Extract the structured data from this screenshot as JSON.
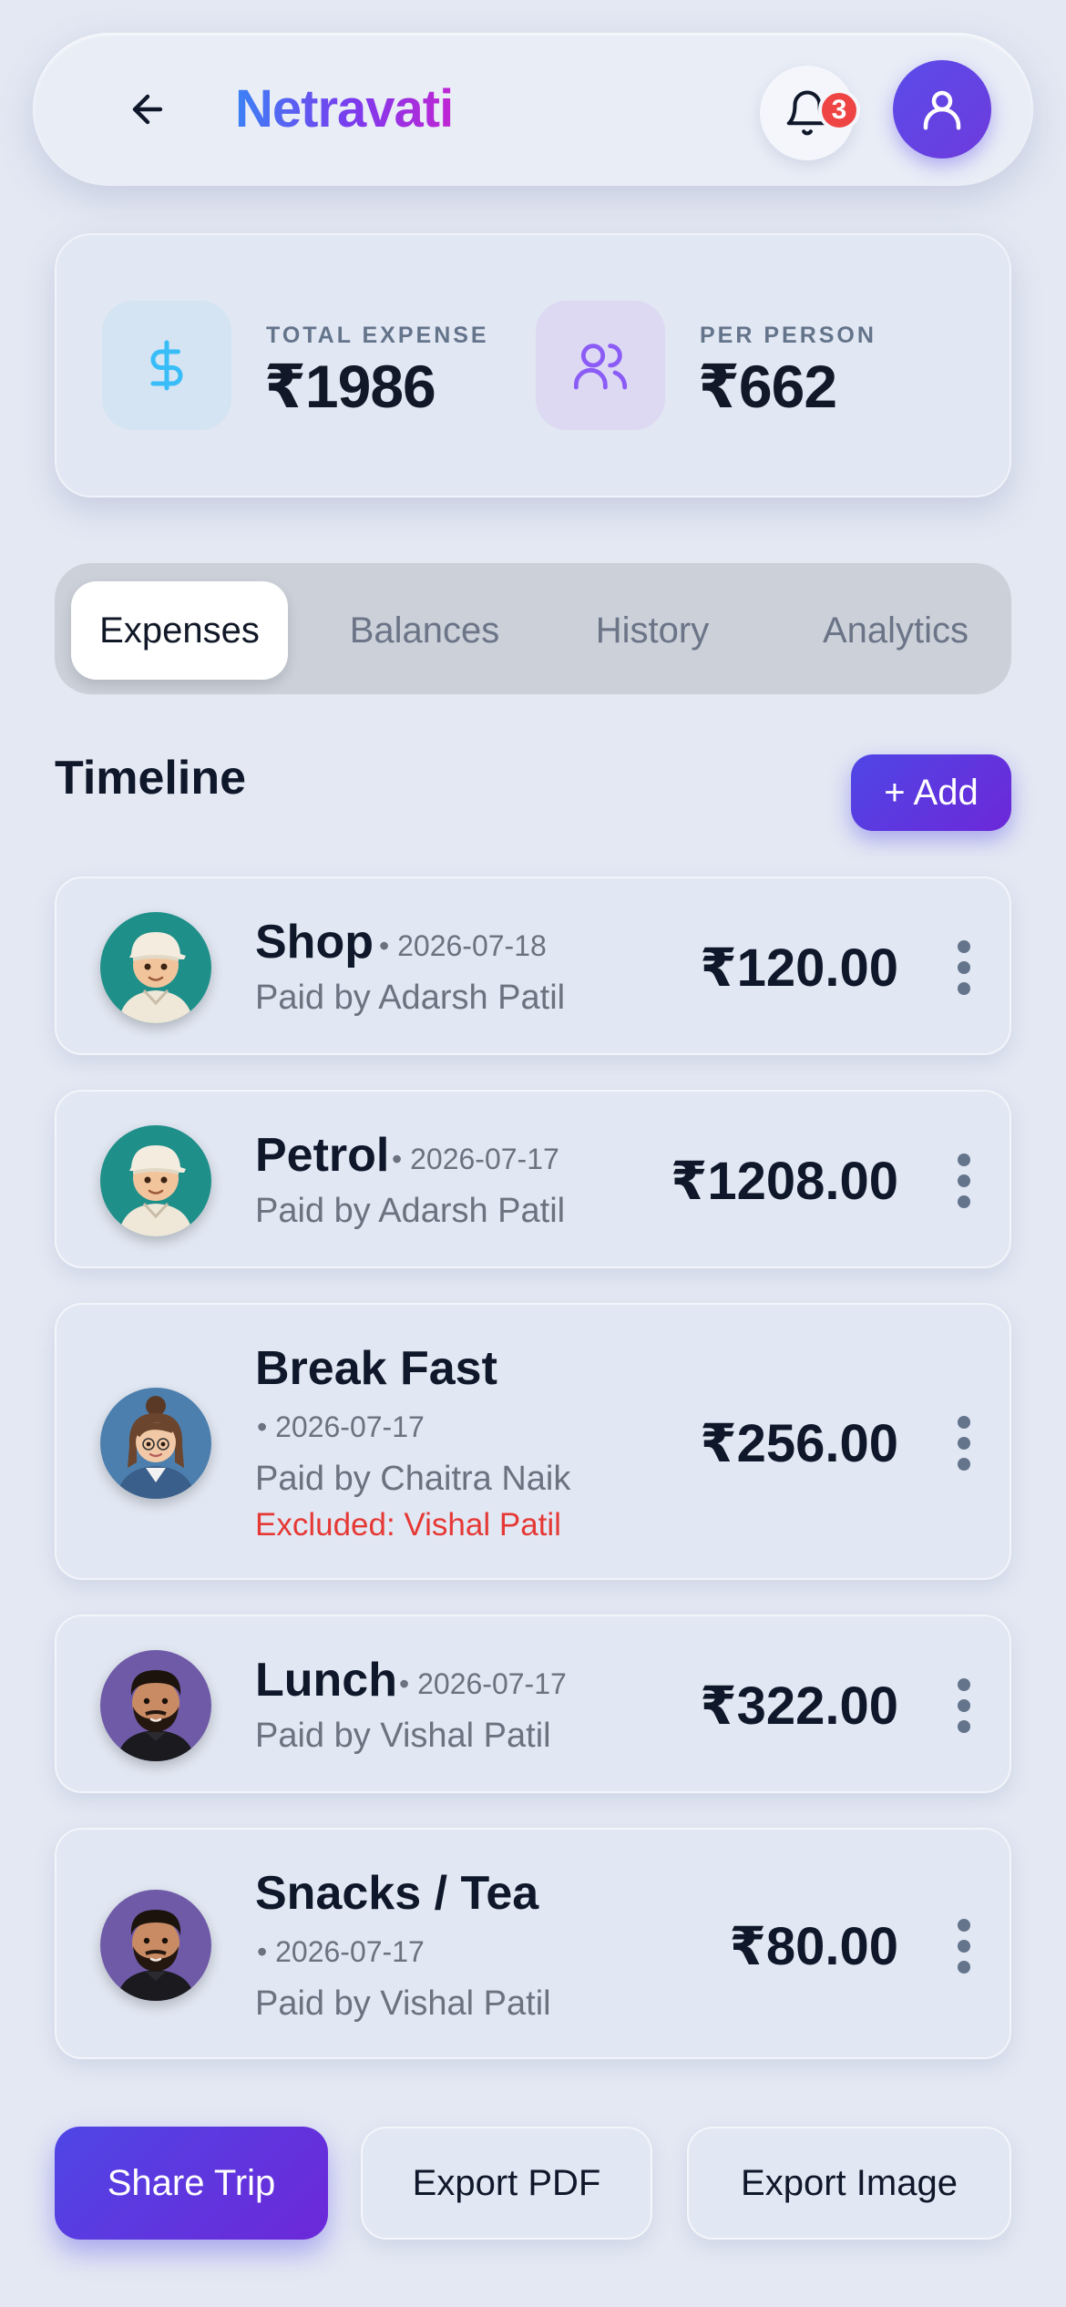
{
  "header": {
    "title": "Netravati",
    "notification_count": "3"
  },
  "summary": {
    "total_label": "TOTAL EXPENSE",
    "total_value": "₹1986",
    "per_person_label": "PER PERSON",
    "per_person_value": "₹662"
  },
  "tabs": [
    {
      "label": "Expenses",
      "active": true
    },
    {
      "label": "Balances",
      "active": false
    },
    {
      "label": "History",
      "active": false
    },
    {
      "label": "Analytics",
      "active": false
    }
  ],
  "timeline": {
    "title": "Timeline",
    "add_label": "+ Add",
    "expenses": [
      {
        "title": "Shop",
        "date": "• 2026-07-18",
        "paid_by": "Paid by Adarsh Patil",
        "amount": "₹120.00",
        "avatar": "boy-cap-avatar"
      },
      {
        "title": "Petrol",
        "date": "• 2026-07-17",
        "paid_by": "Paid by Adarsh Patil",
        "amount": "₹1208.00",
        "avatar": "boy-cap-avatar"
      },
      {
        "title": "Break Fast",
        "date": "• 2026-07-17",
        "paid_by": "Paid by Chaitra Naik",
        "excluded": "Excluded: Vishal Patil",
        "amount": "₹256.00",
        "avatar": "girl-avatar"
      },
      {
        "title": "Lunch",
        "date": "• 2026-07-17",
        "paid_by": "Paid by Vishal Patil",
        "amount": "₹322.00",
        "avatar": "bearded-man-avatar"
      },
      {
        "title": "Snacks / Tea",
        "date": "• 2026-07-17",
        "paid_by": "Paid by Vishal Patil",
        "amount": "₹80.00",
        "avatar": "bearded-man-avatar"
      }
    ]
  },
  "footer": {
    "share_label": "Share Trip",
    "export_pdf_label": "Export PDF",
    "export_image_label": "Export Image"
  },
  "colors": {
    "accent": "#4f46e5",
    "danger": "#e53935",
    "background": "#e3e8f3"
  }
}
